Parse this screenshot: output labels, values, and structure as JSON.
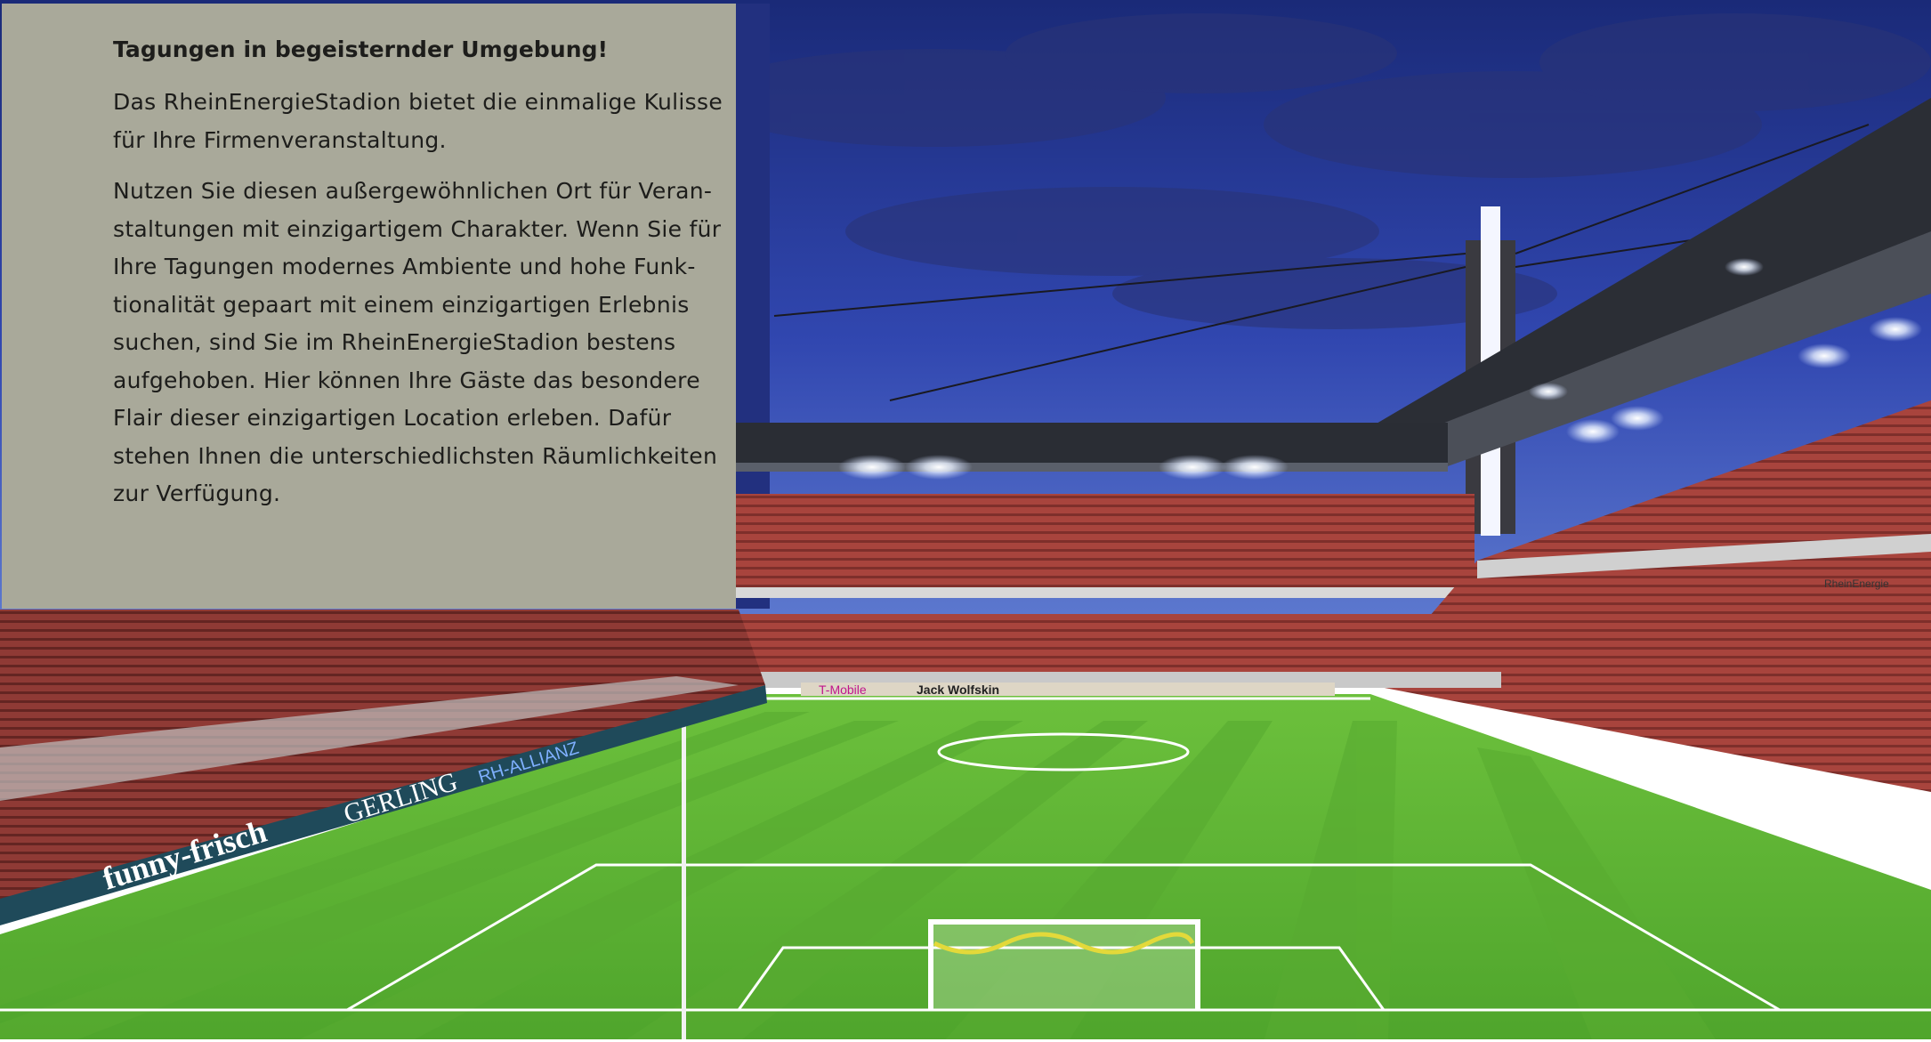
{
  "article": {
    "heading": "Tagungen in begeisternder Umgebung!",
    "intro_lines": [
      "Das RheinEnergieStadion bietet die einmalige Kulisse",
      "für Ihre Firmenveranstaltung."
    ],
    "body_lines": [
      "Nutzen Sie diesen außergewöhnlichen Ort für Veran-",
      "staltungen mit einzigartigem Charakter. Wenn Sie für",
      "Ihre Tagungen modernes Ambiente und hohe Funk-",
      "tionalität gepaart mit einem einzigartigen Erlebnis",
      "suchen, sind Sie im RheinEnergieStadion bestens",
      "aufgehoben. Hier können Ihre Gäste das besondere",
      "Flair dieser einzigartigen Location erleben. Dafür",
      "stehen Ihnen die unterschiedlichsten Räumlichkeiten",
      "zur Verfügung."
    ]
  },
  "photo": {
    "board_texts": [
      "funny-frisch",
      "GERLING",
      "RH-ALLIANZ",
      "Jack Wolfskin",
      "T-Mobile",
      "RheinEnergie"
    ],
    "colors": {
      "sky_top": "#1c2e7a",
      "sky_bottom": "#5b73c8",
      "pitch": "#5fb336",
      "seats": "#b04a42",
      "panel": "#a9a99a"
    }
  }
}
